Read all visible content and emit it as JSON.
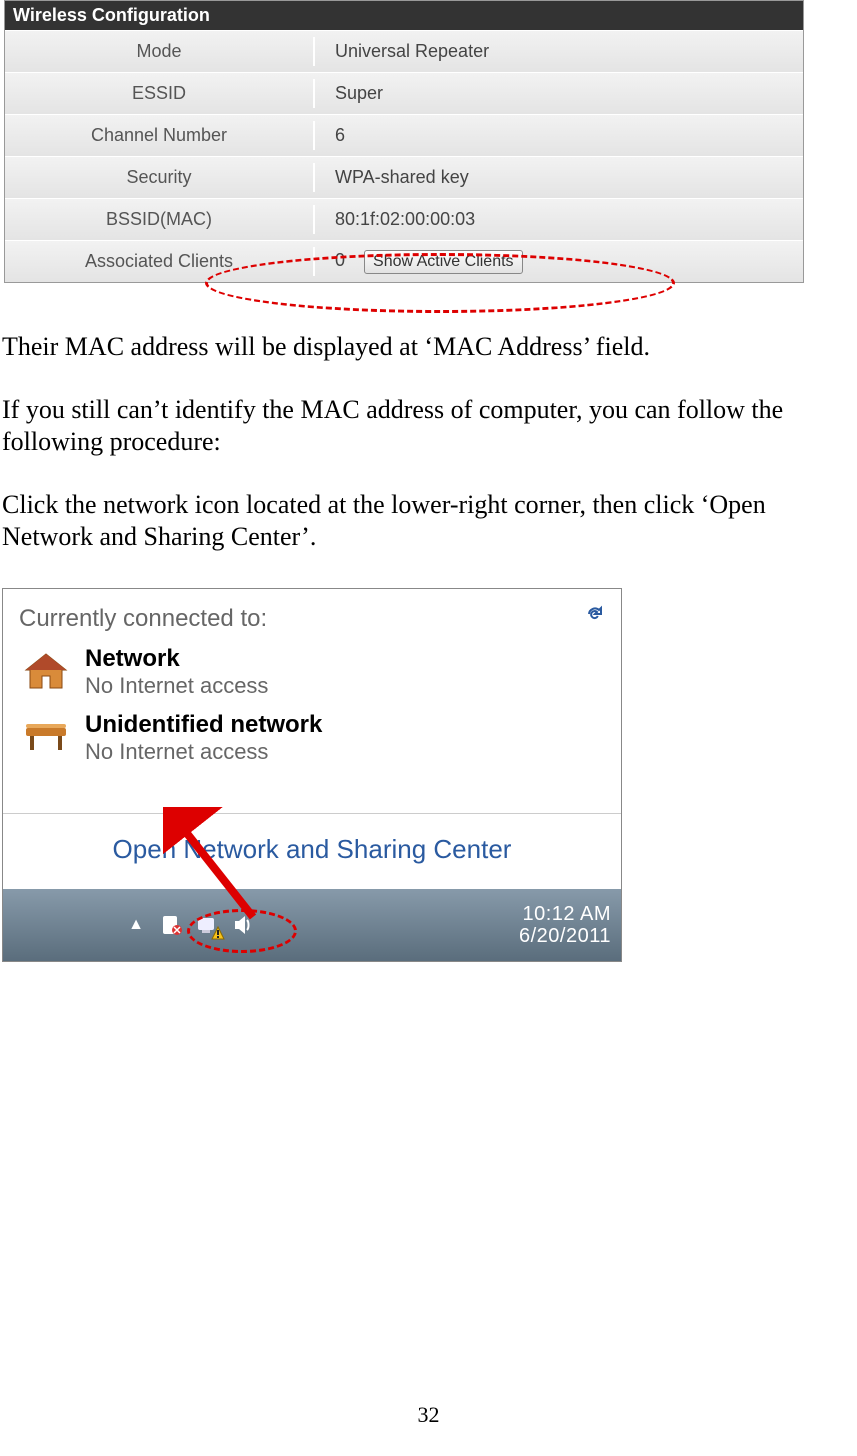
{
  "wireless": {
    "header": "Wireless Configuration",
    "rows": [
      {
        "label": "Mode",
        "value": "Universal Repeater"
      },
      {
        "label": "ESSID",
        "value": "Super"
      },
      {
        "label": "Channel Number",
        "value": "6"
      },
      {
        "label": "Security",
        "value": "WPA-shared key"
      },
      {
        "label": "BSSID(MAC)",
        "value": "80:1f:02:00:00:03"
      }
    ],
    "assoc_label": "Associated Clients",
    "assoc_count": "0",
    "assoc_button": "Show Active Clients"
  },
  "paragraphs": {
    "p1": "Their MAC address will be displayed at ‘MAC Address’ field.",
    "p2": "If you still can’t identify the MAC address of computer, you can follow the following procedure:",
    "p3": "Click the network icon located at the lower-right corner, then click ‘Open Network and Sharing Center’."
  },
  "popup": {
    "heading": "Currently connected to:",
    "net1_name": "Network",
    "net1_status": "No Internet access",
    "net2_name": "Unidentified network",
    "net2_status": "No Internet access",
    "link": "Open Network and Sharing Center"
  },
  "taskbar": {
    "time": "10:12 AM",
    "date": "6/20/2011"
  },
  "page_number": "32"
}
